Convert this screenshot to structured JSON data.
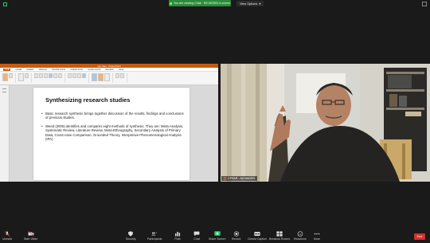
{
  "top_bar": {
    "share_banner_label": "You are viewing Chair · RE-MODEL's screen",
    "view_options_label": "View Options",
    "chevron": "▾"
  },
  "presentation": {
    "window_title": "syn-thes - PowerPoint",
    "tabs": [
      "FILE",
      "HOME",
      "INSERT",
      "DESIGN",
      "TRANSITIONS",
      "ANIMATIONS",
      "SLIDE SHOW",
      "REVIEW",
      "VIEW"
    ],
    "slide_title": "Synthesizing research studies",
    "bullets": [
      "Basic research synthesis brings together discussion of the results, findings and conclusions of previous studies.",
      "Weed (2005) identifies and compares eight methods of synthesis. They are: Meta-Analysis, Systematic Review, Literature Review, Meta-Ethnography, Secondary Analysis of Primary Data, Cross-case Comparison, Grounded Theory, Interpretive Phenomenological Analysis (IPA)"
    ]
  },
  "video": {
    "participant_name": "CPSAR - Ali HAIDER"
  },
  "toolbar": {
    "items": [
      {
        "label": "Unmute",
        "icon": "mic-muted-icon"
      },
      {
        "label": "Start Video",
        "icon": "video-off-icon"
      },
      {
        "label": "Security",
        "icon": "shield-icon"
      },
      {
        "label": "Participants",
        "icon": "participants-icon"
      },
      {
        "label": "Polls",
        "icon": "polls-icon"
      },
      {
        "label": "Chat",
        "icon": "chat-icon"
      },
      {
        "label": "Share Screen",
        "icon": "share-screen-icon"
      },
      {
        "label": "Record",
        "icon": "record-icon"
      },
      {
        "label": "Closed Caption",
        "icon": "cc-icon"
      },
      {
        "label": "Breakout Rooms",
        "icon": "breakout-icon"
      },
      {
        "label": "Reactions",
        "icon": "reactions-icon"
      },
      {
        "label": "More",
        "icon": "more-icon"
      }
    ],
    "participants_count": "6",
    "end_label": "End"
  },
  "colors": {
    "background": "#1a1a1a",
    "share_green": "#2d8c3c",
    "end_red": "#d0312d",
    "ppt_orange": "#c55a11"
  }
}
